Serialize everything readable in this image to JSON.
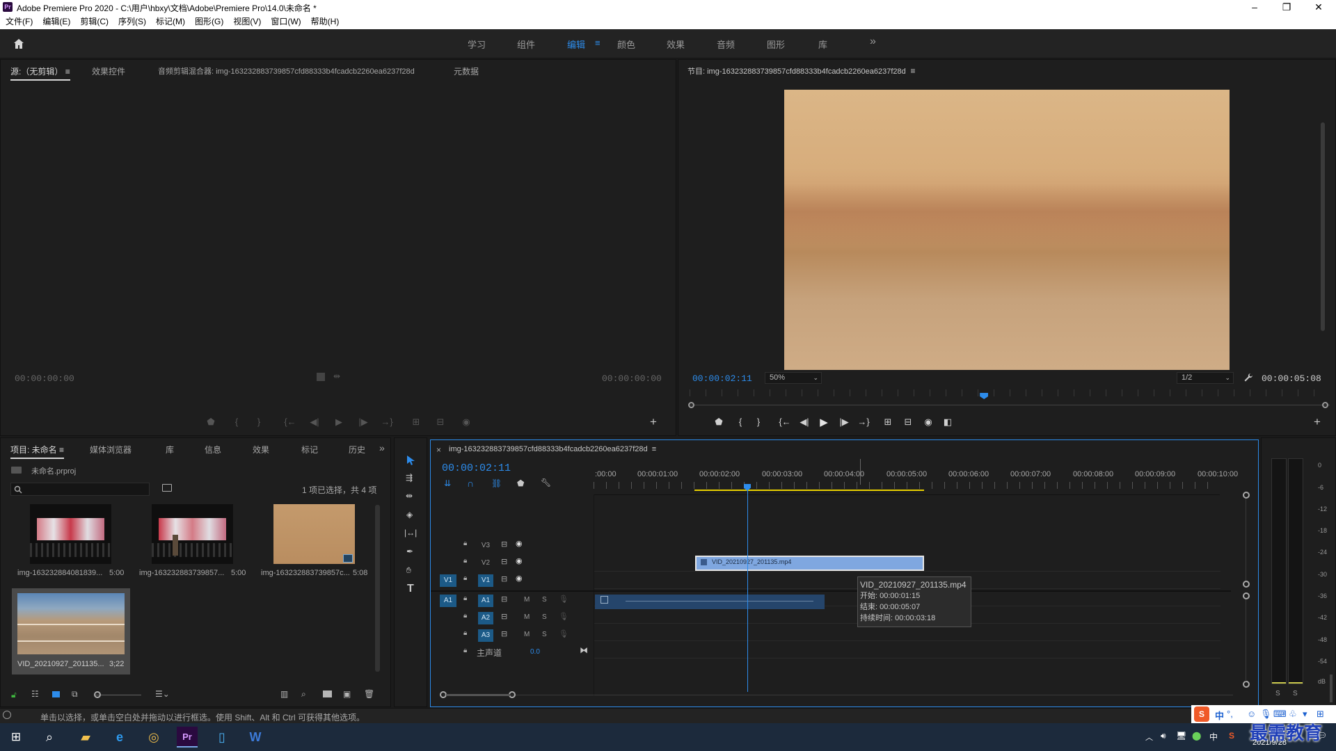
{
  "titlebar": {
    "app_icon": "Pr",
    "title": "Adobe Premiere Pro 2020 - C:\\用户\\hbxy\\文档\\Adobe\\Premiere Pro\\14.0\\未命名 *",
    "minimize": "–",
    "maximize": "❐",
    "close": "✕"
  },
  "menu": [
    "文件(F)",
    "编辑(E)",
    "剪辑(C)",
    "序列(S)",
    "标记(M)",
    "图形(G)",
    "视图(V)",
    "窗口(W)",
    "帮助(H)"
  ],
  "workspaces": {
    "home_icon": "home-icon",
    "tabs": [
      "学习",
      "组件",
      "编辑",
      "颜色",
      "效果",
      "音频",
      "图形",
      "库"
    ],
    "active": "编辑",
    "menu_glyph": "≡",
    "more": "»"
  },
  "source_panel": {
    "tabs": [
      "源:（无剪辑）",
      "效果控件",
      "音频剪辑混合器: img-163232883739857cfd88333b4fcadcb2260ea6237f28d",
      "元数据"
    ],
    "menu_glyph": "≡",
    "timecode_left": "00:00:00:00",
    "timecode_right": "00:00:00:00",
    "add": "+"
  },
  "program_panel": {
    "title": "节目: img-163232883739857cfd88333b4fcadcb2260ea6237f28d",
    "menu_glyph": "≡",
    "timecode": "00:00:02:11",
    "zoom": "50%",
    "resolution": "1/2",
    "duration": "00:00:05:08",
    "add": "+",
    "playhead_fraction": 0.46
  },
  "project_panel": {
    "tabs": [
      "项目: 未命名",
      "媒体浏览器",
      "库",
      "信息",
      "效果",
      "标记",
      "历史"
    ],
    "menu_glyph": "≡",
    "more": "»",
    "file": "未命名.prproj",
    "selection_info": "1 项已选择，共 4 项",
    "items": [
      {
        "name": "img-163232884081839...",
        "duration": "5:00"
      },
      {
        "name": "img-163232883739857...",
        "duration": "5:00"
      },
      {
        "name": "img-163232883739857c...",
        "duration": "5:08"
      },
      {
        "name": "VID_20210927_201135...",
        "duration": "3;22"
      }
    ]
  },
  "timeline": {
    "close": "×",
    "sequence": "img-163232883739857cfd88333b4fcadcb2260ea6237f28d",
    "menu_glyph": "≡",
    "timecode": "00:00:02:11",
    "ruler": [
      ":00:00",
      "00:00:01:00",
      "00:00:02:00",
      "00:00:03:00",
      "00:00:04:00",
      "00:00:05:00",
      "00:00:06:00",
      "00:00:07:00",
      "00:00:08:00",
      "00:00:09:00",
      "00:00:10:00"
    ],
    "video_tracks": [
      "V3",
      "V2",
      "V1"
    ],
    "audio_tracks": [
      "A1",
      "A2",
      "A3"
    ],
    "source_v": "V1",
    "source_a": "A1",
    "mute": "M",
    "solo": "S",
    "master_label": "主声道",
    "master_value": "0.0",
    "clip_v2": "VID_20210927_201135.mp4",
    "tooltip": {
      "name": "VID_20210927_201135.mp4",
      "start": "开始: 00:00:01:15",
      "end": "结束: 00:00:05:07",
      "duration": "持续时间: 00:00:03:18"
    }
  },
  "audio_meter": {
    "scale": [
      "0",
      "-6",
      "-12",
      "-18",
      "-24",
      "-30",
      "-36",
      "-42",
      "-48",
      "-54",
      "dB"
    ],
    "solo_left": "S",
    "solo_right": "S"
  },
  "status_bar": "单击以选择，或单击空白处并拖动以进行框选。使用 Shift、Alt 和 Ctrl 可获得其他选项。",
  "ime": {
    "label": "中",
    "punct": "°,"
  },
  "taskbar": {
    "date": "2021/9/28",
    "watermark": "最需教育"
  }
}
